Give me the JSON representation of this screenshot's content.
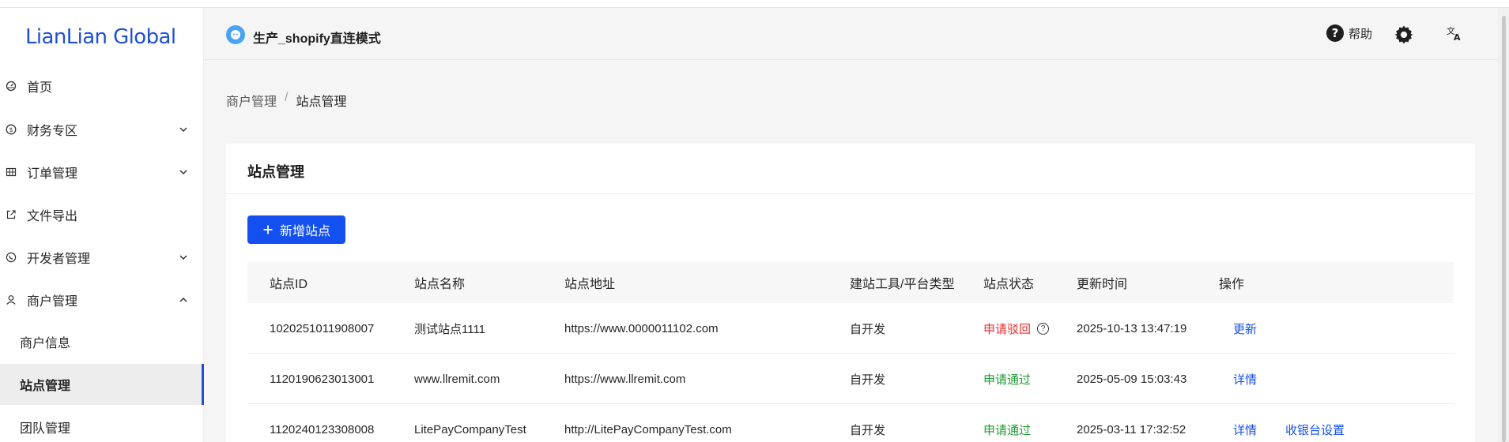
{
  "brand": {
    "logo_text": "LianLian Global"
  },
  "sidebar": {
    "items": [
      {
        "label": "首页",
        "icon": "dashboard-icon"
      },
      {
        "label": "财务专区",
        "icon": "dollar-icon"
      },
      {
        "label": "订单管理",
        "icon": "table-icon"
      },
      {
        "label": "文件导出",
        "icon": "export-icon"
      },
      {
        "label": "开发者管理",
        "icon": "whatsapp-icon"
      },
      {
        "label": "商户管理",
        "icon": "user-icon"
      }
    ],
    "sub_items": [
      {
        "label": "商户信息"
      },
      {
        "label": "站点管理",
        "active": true
      },
      {
        "label": "团队管理"
      }
    ]
  },
  "header": {
    "store_name": "生产_shopify直连模式",
    "help_label": "帮助"
  },
  "breadcrumb": {
    "parent": "商户管理",
    "separator": "/",
    "current": "站点管理"
  },
  "card": {
    "title": "站点管理",
    "add_button": "新增站点"
  },
  "table": {
    "columns": [
      "站点ID",
      "站点名称",
      "站点地址",
      "建站工具/平台类型",
      "站点状态",
      "更新时间",
      "操作"
    ],
    "rows": [
      {
        "id": "1020251011908007",
        "name": "测试站点1111",
        "url": "https://www.0000011102.com",
        "platform": "自开发",
        "status": "申请驳回",
        "status_type": "rejected",
        "updated": "2025-10-13 13:47:19",
        "action1": "更新",
        "action2": ""
      },
      {
        "id": "1120190623013001",
        "name": "www.llremit.com",
        "url": "https://www.llremit.com",
        "platform": "自开发",
        "status": "申请通过",
        "status_type": "approved",
        "updated": "2025-05-09 15:03:43",
        "action1": "详情",
        "action2": ""
      },
      {
        "id": "1120240123308008",
        "name": "LitePayCompanyTest",
        "url": "http://LitePayCompanyTest.com",
        "platform": "自开发",
        "status": "申请通过",
        "status_type": "approved",
        "updated": "2025-03-11 17:32:52",
        "action1": "详情",
        "action2": "收银台设置"
      }
    ]
  },
  "colors": {
    "brand_blue": "#1450f0",
    "status_rejected": "#ee2c2c",
    "status_approved": "#1f9d33"
  }
}
